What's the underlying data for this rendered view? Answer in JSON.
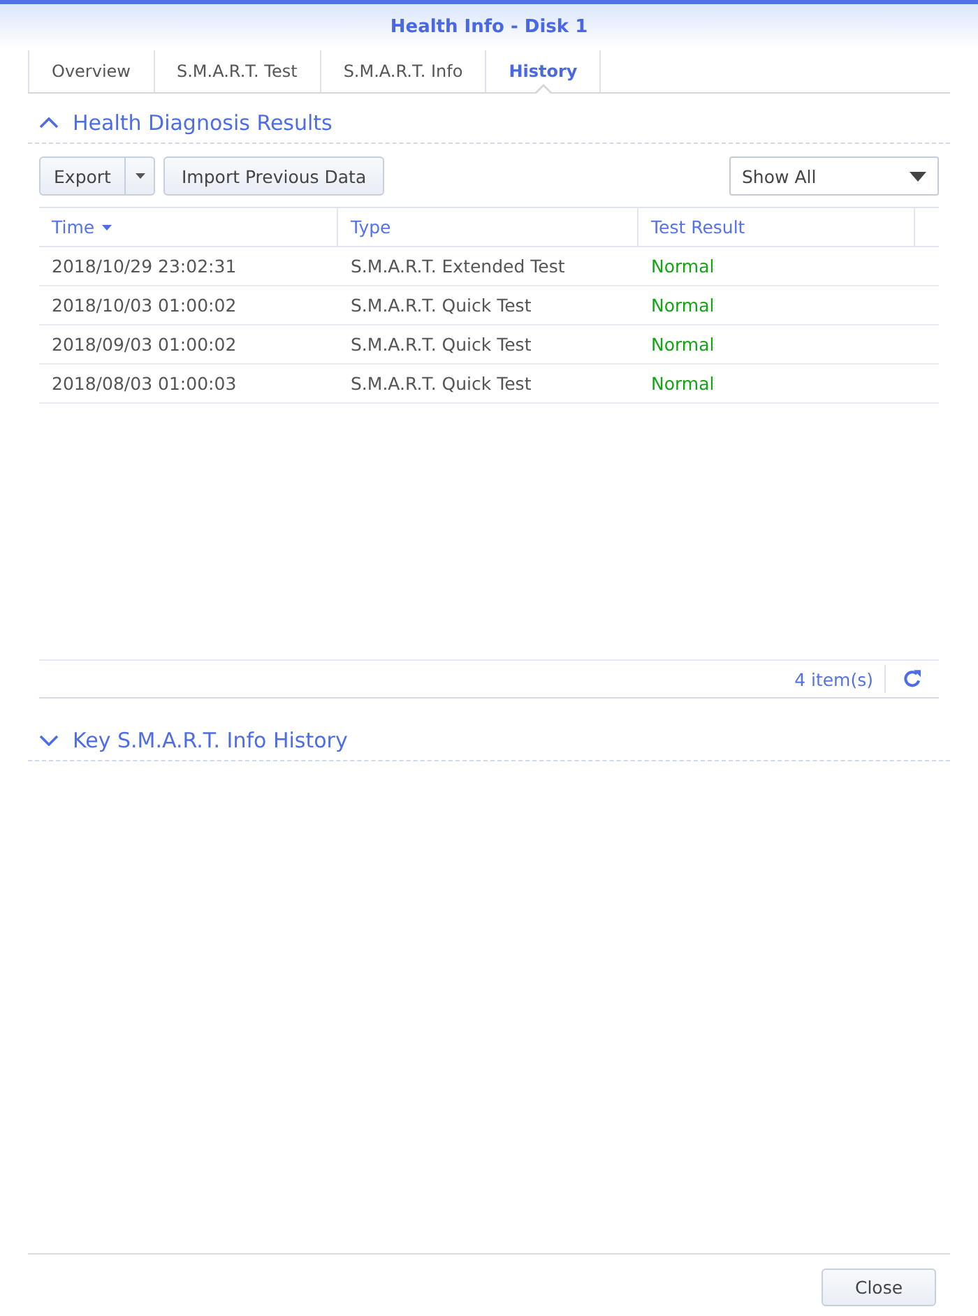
{
  "window": {
    "title": "Health Info - Disk 1"
  },
  "tabs": [
    {
      "label": "Overview",
      "selected": false
    },
    {
      "label": "S.M.A.R.T. Test",
      "selected": false
    },
    {
      "label": "S.M.A.R.T. Info",
      "selected": false
    },
    {
      "label": "History",
      "selected": true
    }
  ],
  "sections": [
    {
      "title": "Health Diagnosis Results",
      "expanded": true,
      "toolbar": {
        "export_label": "Export",
        "import_label": "Import Previous Data",
        "filter": "Show All"
      },
      "table": {
        "columns": [
          {
            "label": "Time",
            "sorted": true
          },
          {
            "label": "Type",
            "sorted": false
          },
          {
            "label": "Test Result",
            "sorted": false
          }
        ],
        "rows": [
          {
            "cells": [
              "2018/10/29 23:02:31",
              "S.M.A.R.T. Extended Test",
              "Normal"
            ],
            "passed": true
          },
          {
            "cells": [
              "2018/10/03 01:00:02",
              "S.M.A.R.T. Quick Test",
              "Normal"
            ],
            "passed": true
          },
          {
            "cells": [
              "2018/09/03 01:00:02",
              "S.M.A.R.T. Quick Test",
              "Normal"
            ],
            "passed": true
          },
          {
            "cells": [
              "2018/08/03 01:00:03",
              "S.M.A.R.T. Quick Test",
              "Normal"
            ],
            "passed": true
          }
        ]
      },
      "item_count": "4 item(s)"
    },
    {
      "title": "Key S.M.A.R.T. Info History",
      "expanded": false
    }
  ],
  "buttons": [
    {
      "label": "Close"
    }
  ]
}
